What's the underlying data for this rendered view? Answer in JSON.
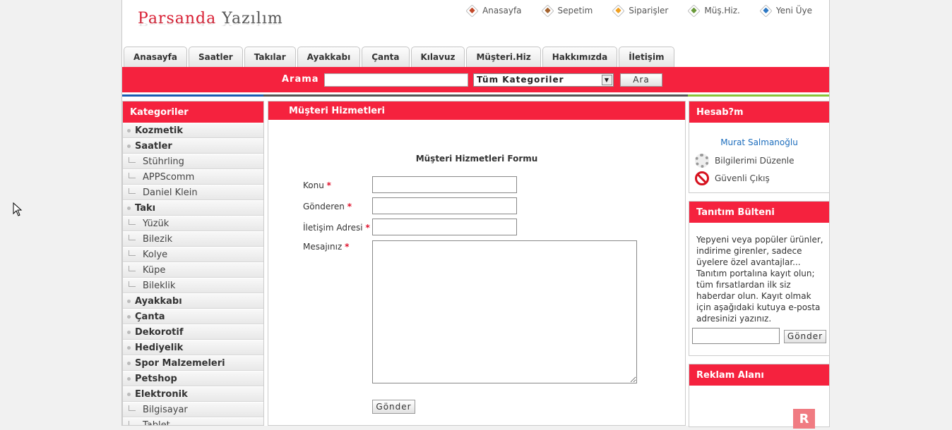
{
  "logo": {
    "part1": "Parsanda",
    "part2": "Yazılım"
  },
  "toplinks": [
    {
      "label": "Anasayfa",
      "color": "red"
    },
    {
      "label": "Sepetim",
      "color": "brown"
    },
    {
      "label": "Siparişler",
      "color": "orange"
    },
    {
      "label": "Müş.Hiz.",
      "color": "green"
    },
    {
      "label": "Yeni Üye",
      "color": "blue"
    }
  ],
  "tabs": [
    "Anasayfa",
    "Saatler",
    "Takılar",
    "Ayakkabı",
    "Çanta",
    "Kılavuz",
    "Müşteri.Hiz",
    "Hakkımızda",
    "İletişim"
  ],
  "search": {
    "label": "Arama",
    "value": "",
    "category": "Tüm Kategoriler",
    "button": "Ara"
  },
  "categories": {
    "title": "Kategoriler",
    "items": [
      {
        "label": "Kozmetik",
        "level": 0
      },
      {
        "label": "Saatler",
        "level": 0
      },
      {
        "label": "Stührling",
        "level": 1
      },
      {
        "label": "APPScomm",
        "level": 1
      },
      {
        "label": "Daniel Klein",
        "level": 1
      },
      {
        "label": "Takı",
        "level": 0
      },
      {
        "label": "Yüzük",
        "level": 1
      },
      {
        "label": "Bilezik",
        "level": 1
      },
      {
        "label": "Kolye",
        "level": 1
      },
      {
        "label": "Küpe",
        "level": 1
      },
      {
        "label": "Bileklik",
        "level": 1
      },
      {
        "label": "Ayakkabı",
        "level": 0
      },
      {
        "label": "Çanta",
        "level": 0
      },
      {
        "label": "Dekorotif",
        "level": 0
      },
      {
        "label": "Hediyelik",
        "level": 0
      },
      {
        "label": "Spor Malzemeleri",
        "level": 0
      },
      {
        "label": "Petshop",
        "level": 0
      },
      {
        "label": "Elektronik",
        "level": 0
      },
      {
        "label": "Bilgisayar",
        "level": 1
      },
      {
        "label": "Tablet",
        "level": 1
      }
    ]
  },
  "main": {
    "title": "Müşteri Hizmetleri",
    "form_title": "Müşteri Hizmetleri Formu",
    "fields": {
      "subject": "Konu",
      "sender": "Gönderen",
      "contact": "İletişim Adresi",
      "message": "Mesajınız"
    },
    "required_mark": "*",
    "submit": "Gönder"
  },
  "account": {
    "title": "Hesab?m",
    "user": "Murat Salmanoğlu",
    "edit": "Bilgilerimi Düzenle",
    "logout": "Güvenli Çıkış"
  },
  "newsletter": {
    "title": "Tanıtım Bülteni",
    "text": "Yepyeni veya popüler ürünler, indirime girenler, sadece üyelere özel avantajlar... Tanıtım portalına kayıt olun; tüm fırsatlardan ilk siz haberdar olun. Kayıt olmak için aşağıdaki kutuya e-posta adresinizi yazınız.",
    "button": "Gönder"
  },
  "ad": {
    "title": "Reklam Alanı",
    "logo_letter": "R"
  },
  "colors": {
    "accent": "#f5223e",
    "link": "#1c6dbd"
  }
}
